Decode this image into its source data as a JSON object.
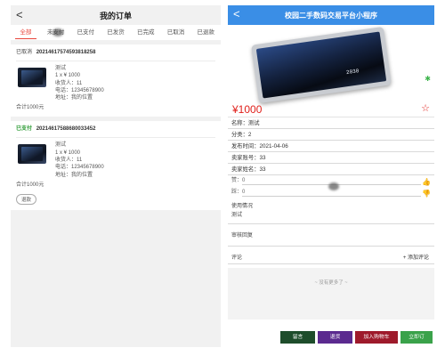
{
  "left": {
    "back_glyph": "<",
    "title": "我的订单",
    "tabs": [
      "全部",
      "未支付",
      "已支付",
      "已发货",
      "已完成",
      "已取消",
      "已退款"
    ],
    "orders": [
      {
        "status": "已取消",
        "order_no": "20214617574593818258",
        "product": "测试",
        "qty_price": "1 x ¥ 1000",
        "receiver": "收货人：11",
        "phone": "电话：12345678900",
        "address": "地址：我的位置",
        "total": "合计1000元"
      },
      {
        "status": "已支付",
        "order_no": "20214617588680033452",
        "product": "测试",
        "qty_price": "1 x ¥ 1000",
        "receiver": "收货人：11",
        "phone": "电话：12345678900",
        "address": "地址：我的位置",
        "total": "合计1000元",
        "refund_label": "退款"
      }
    ]
  },
  "right": {
    "back_glyph": "<",
    "title": "校园二手数码交易平台小程序",
    "image_text": "2030",
    "price": "¥1000",
    "fields": {
      "name": "名称：测试",
      "category": "分类：2",
      "publish_time": "发布时间：2021-04-06",
      "seller_account": "卖家账号：33",
      "seller_name": "卖家姓名：33"
    },
    "likes": "赞：0",
    "dislikes": "踩：0",
    "usage_label": "使用情况",
    "usage_value": "测试",
    "review_label": "审核回复",
    "comment_label": "评论",
    "add_comment": "+ 添加评论",
    "no_more": "~ 没有更多了 ~",
    "buttons": {
      "message": "留言",
      "refund": "退货",
      "cart": "加入购物车",
      "buy": "立即订购"
    }
  },
  "colors": {
    "accent_red": "#e8443a",
    "header_blue": "#3a8ee6",
    "price_red": "#e0201b",
    "paid_green": "#2d9b35"
  },
  "icons": [
    "back-icon",
    "star-icon",
    "thumb-up-icon",
    "thumb-down-icon"
  ]
}
